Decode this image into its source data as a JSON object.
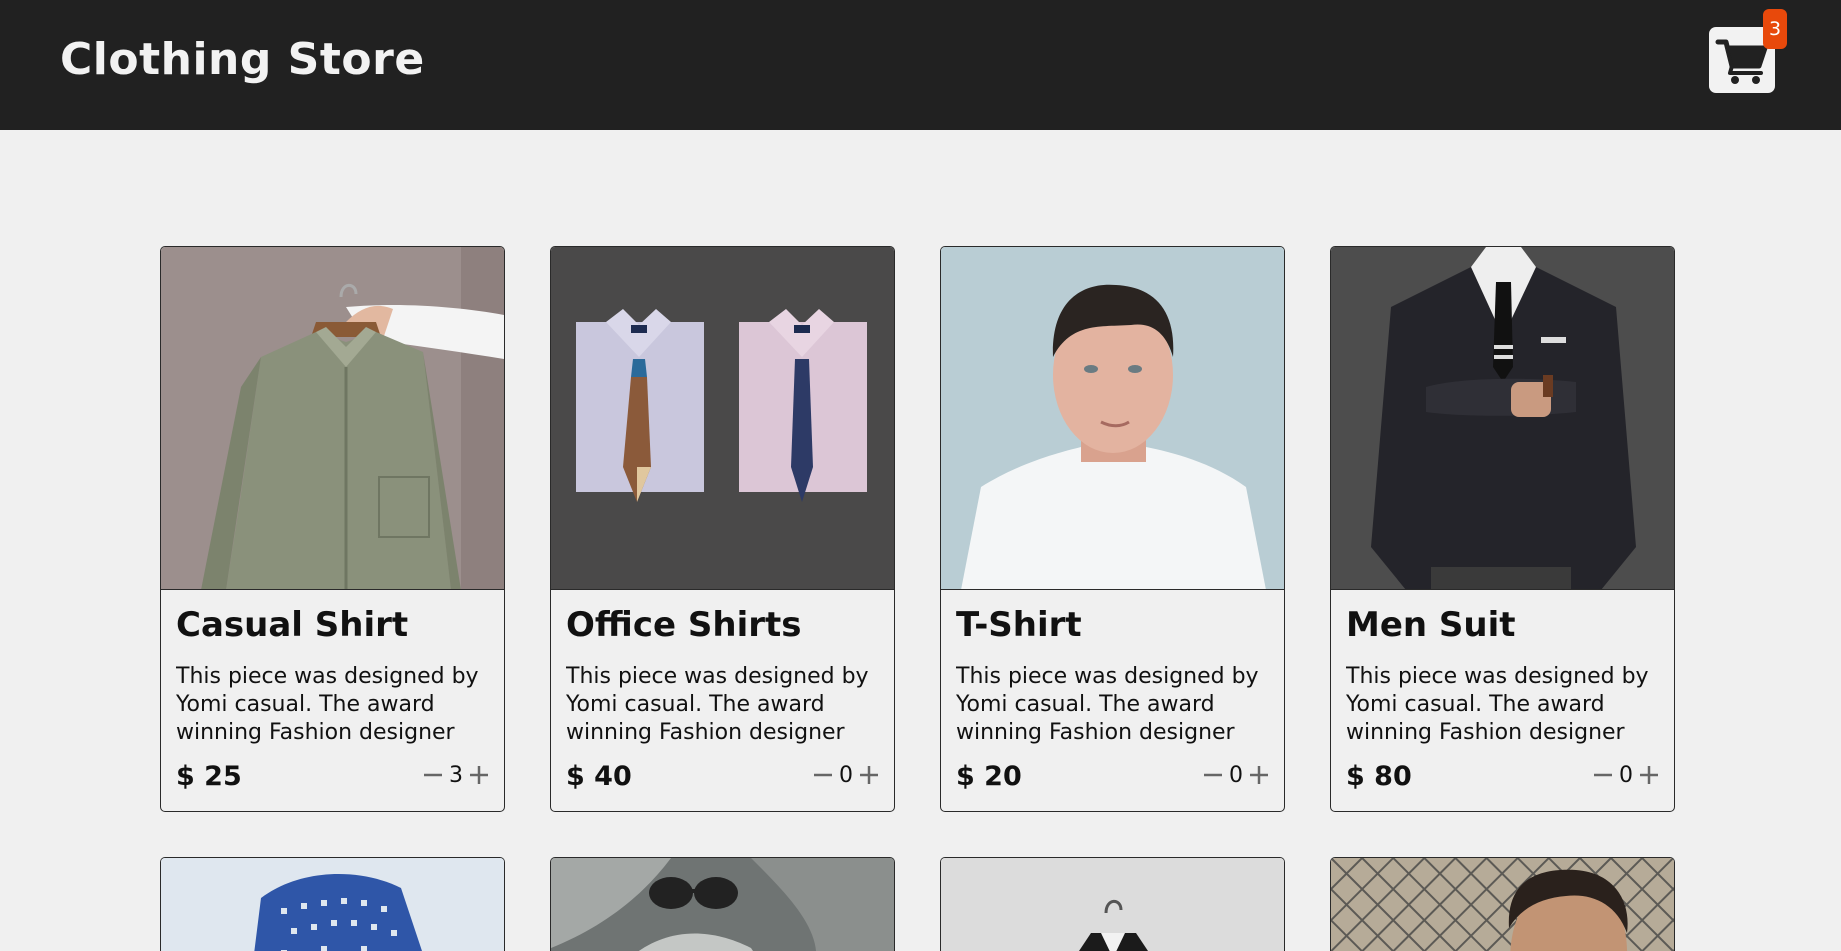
{
  "header": {
    "title": "Clothing Store",
    "cart_count": "3",
    "cart_icon": "shopping-cart-icon"
  },
  "products": [
    {
      "title": "Casual Shirt",
      "description": "This piece was designed by Yomi casual. The award winning Fashion designer",
      "price": "$ 25",
      "quantity": "3",
      "image": "hanging-green-shirt"
    },
    {
      "title": "Office Shirts",
      "description": "This piece was designed by Yomi casual. The award winning Fashion designer",
      "price": "$ 40",
      "quantity": "0",
      "image": "folded-shirts-with-ties"
    },
    {
      "title": "T-Shirt",
      "description": "This piece was designed by Yomi casual. The award winning Fashion designer",
      "price": "$ 20",
      "quantity": "0",
      "image": "man-in-white-tshirt"
    },
    {
      "title": "Men Suit",
      "description": "This piece was designed by Yomi casual. The award winning Fashion designer",
      "price": "$ 80",
      "quantity": "0",
      "image": "dark-suit"
    }
  ],
  "more_products": [
    {
      "image": "blue-patterned-fabric"
    },
    {
      "image": "scarf-and-sunglasses"
    },
    {
      "image": "black-jacket-on-hanger"
    },
    {
      "image": "man-by-chain-fence"
    }
  ],
  "colors": {
    "header_bg": "#212121",
    "page_bg": "#f0f0f0",
    "badge": "#e8490b"
  }
}
